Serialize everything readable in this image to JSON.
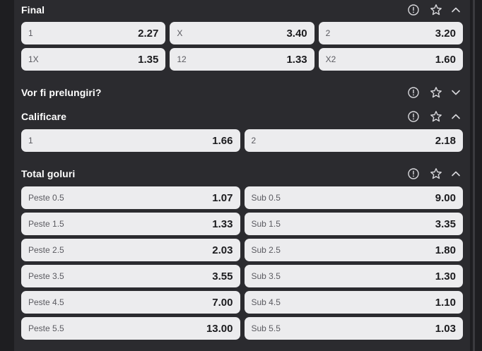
{
  "sections": {
    "final": {
      "title": "Final",
      "rows": [
        [
          {
            "label": "1",
            "value": "2.27"
          },
          {
            "label": "X",
            "value": "3.40"
          },
          {
            "label": "2",
            "value": "3.20"
          }
        ],
        [
          {
            "label": "1X",
            "value": "1.35"
          },
          {
            "label": "12",
            "value": "1.33"
          },
          {
            "label": "X2",
            "value": "1.60"
          }
        ]
      ]
    },
    "prelungiri": {
      "title": "Vor fi prelungiri?"
    },
    "calificare": {
      "title": "Calificare",
      "rows": [
        [
          {
            "label": "1",
            "value": "1.66"
          },
          {
            "label": "2",
            "value": "2.18"
          }
        ]
      ]
    },
    "total_goluri": {
      "title": "Total goluri",
      "rows": [
        [
          {
            "label": "Peste 0.5",
            "value": "1.07"
          },
          {
            "label": "Sub 0.5",
            "value": "9.00"
          }
        ],
        [
          {
            "label": "Peste 1.5",
            "value": "1.33"
          },
          {
            "label": "Sub 1.5",
            "value": "3.35"
          }
        ],
        [
          {
            "label": "Peste 2.5",
            "value": "2.03"
          },
          {
            "label": "Sub 2.5",
            "value": "1.80"
          }
        ],
        [
          {
            "label": "Peste 3.5",
            "value": "3.55"
          },
          {
            "label": "Sub 3.5",
            "value": "1.30"
          }
        ],
        [
          {
            "label": "Peste 4.5",
            "value": "7.00"
          },
          {
            "label": "Sub 4.5",
            "value": "1.10"
          }
        ],
        [
          {
            "label": "Peste 5.5",
            "value": "13.00"
          },
          {
            "label": "Sub 5.5",
            "value": "1.03"
          }
        ]
      ]
    }
  },
  "icons": {
    "info": "info-circle-icon",
    "favorite": "star-outline-icon",
    "collapse": "chevron-up-icon",
    "expand": "chevron-down-icon"
  },
  "colors": {
    "panel_bg": "#2b2b2f",
    "page_bg": "#1e1e21",
    "odd_bg": "#ececee",
    "title_text": "#ffffff"
  }
}
